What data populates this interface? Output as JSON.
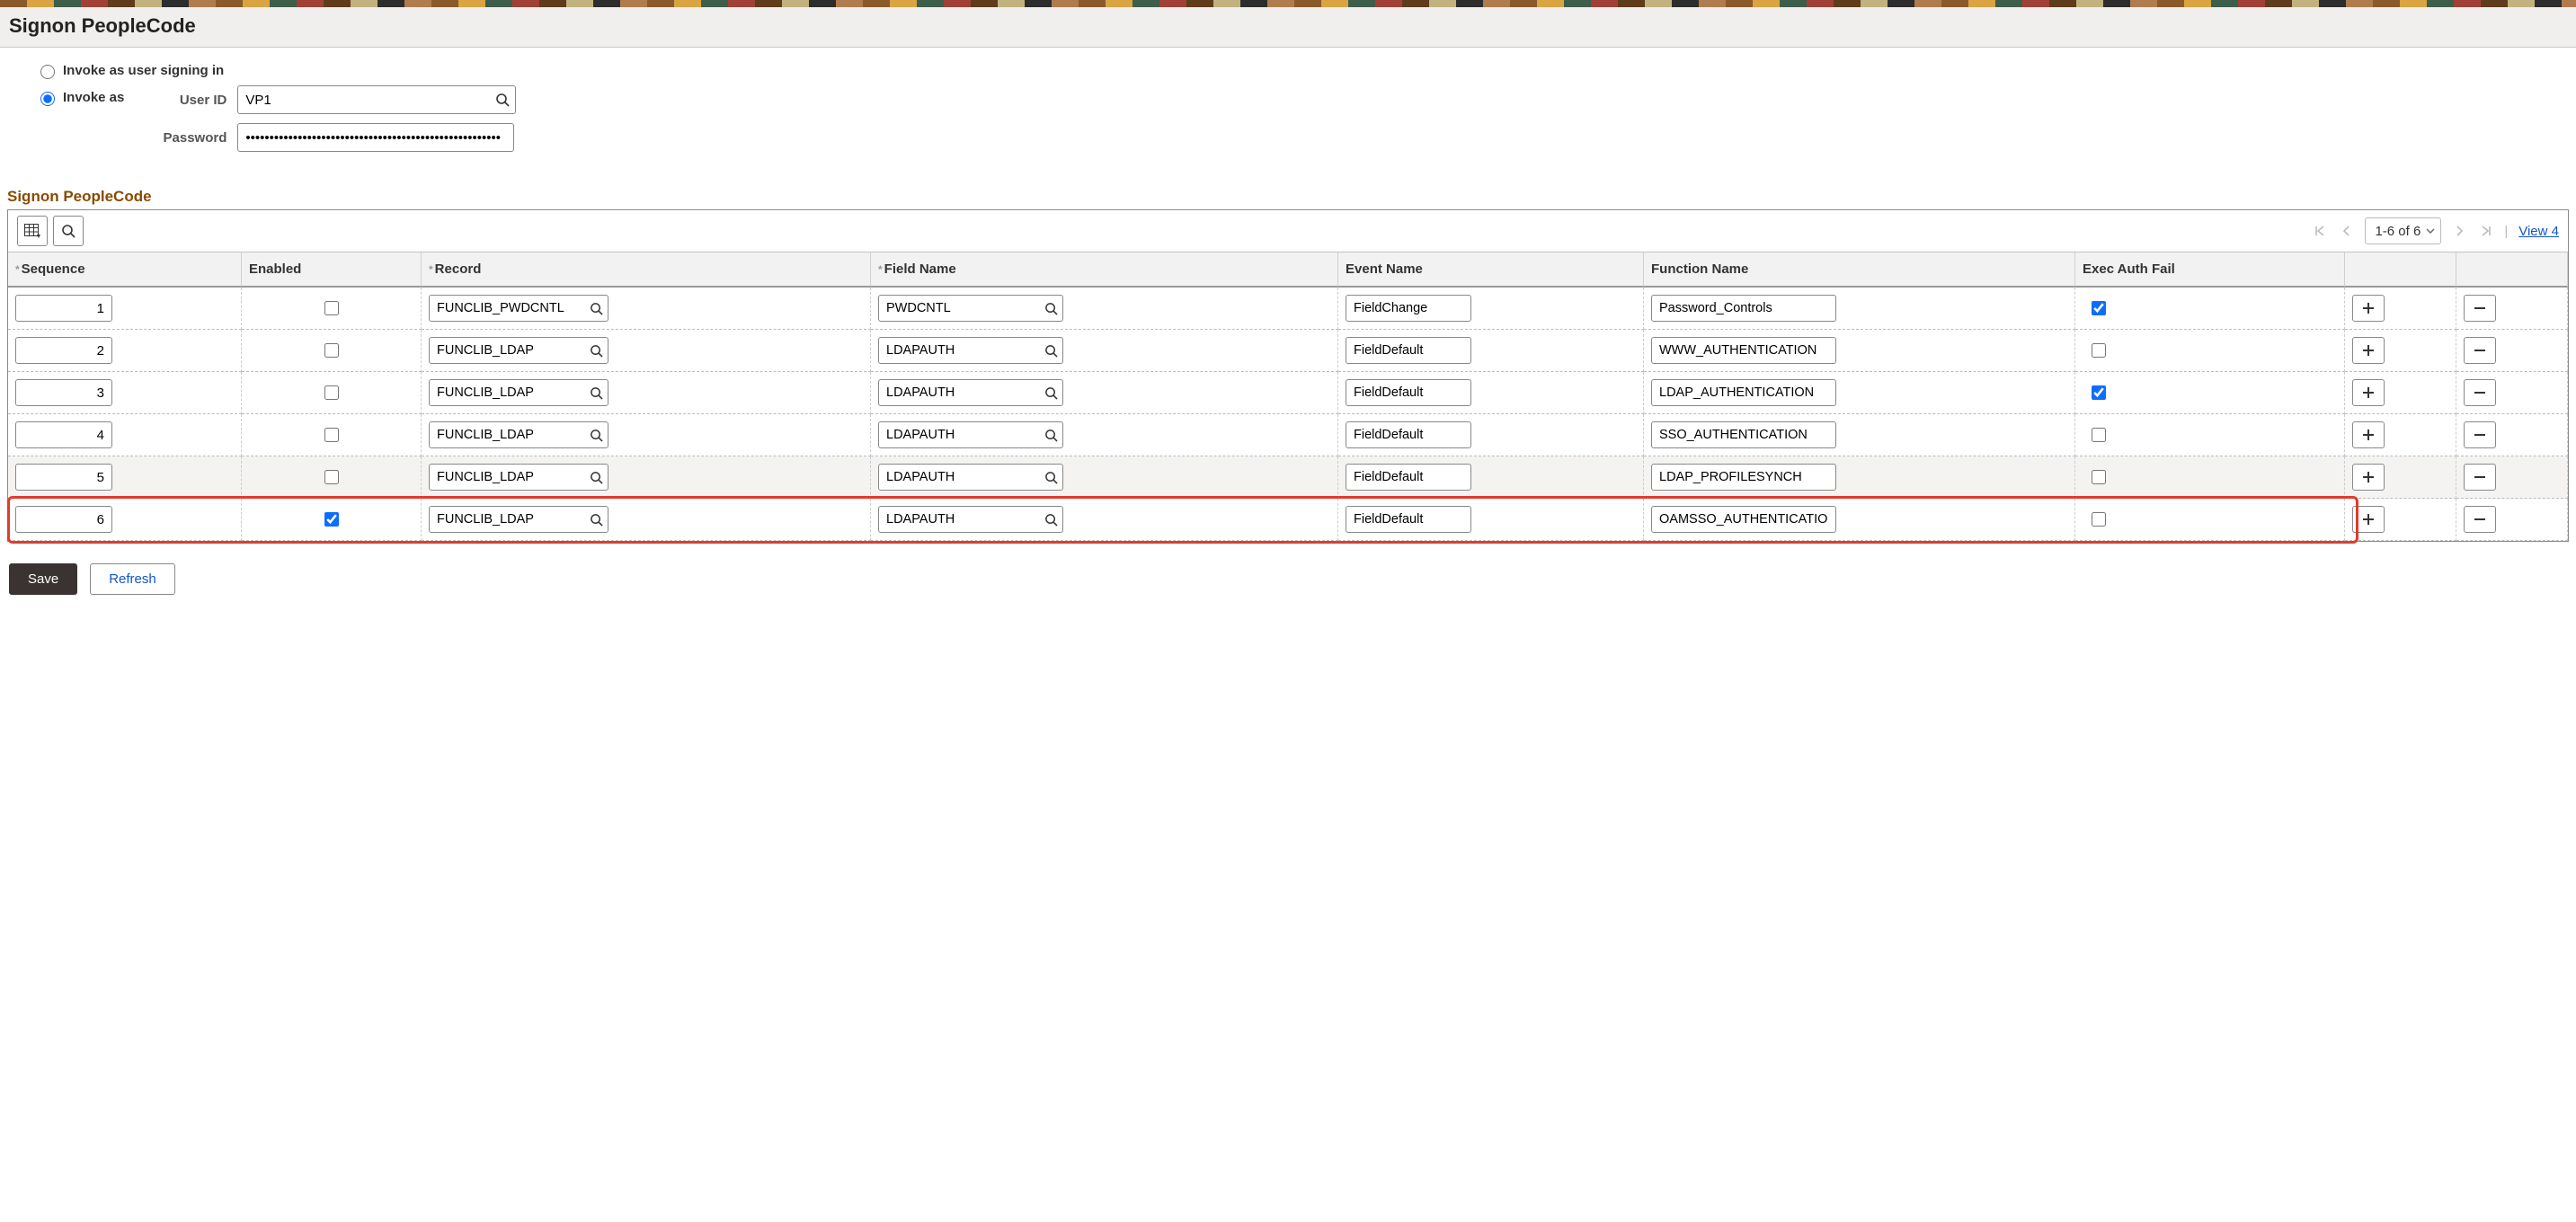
{
  "page": {
    "title": "Signon PeopleCode"
  },
  "invoke": {
    "opt_signing_in": "Invoke as user signing in",
    "opt_as": "Invoke as",
    "selected": "as",
    "userid_label": "User ID",
    "userid_value": "VP1",
    "password_label": "Password",
    "password_value": "••••••••••••••••••••••••••••••••••••••••••••••••••••••"
  },
  "grid": {
    "section_title": "Signon PeopleCode",
    "nav": {
      "range": "1-6 of 6",
      "view_label": "View 4"
    },
    "columns": {
      "sequence": "Sequence",
      "enabled": "Enabled",
      "record": "Record",
      "field": "Field Name",
      "event": "Event Name",
      "func": "Function Name",
      "exec": "Exec Auth Fail"
    },
    "rows": [
      {
        "seq": "1",
        "enabled": false,
        "record": "FUNCLIB_PWDCNTL",
        "field": "PWDCNTL",
        "event": "FieldChange",
        "func": "Password_Controls",
        "exec": true,
        "highlight": false
      },
      {
        "seq": "2",
        "enabled": false,
        "record": "FUNCLIB_LDAP",
        "field": "LDAPAUTH",
        "event": "FieldDefault",
        "func": "WWW_AUTHENTICATION",
        "exec": false,
        "highlight": false
      },
      {
        "seq": "3",
        "enabled": false,
        "record": "FUNCLIB_LDAP",
        "field": "LDAPAUTH",
        "event": "FieldDefault",
        "func": "LDAP_AUTHENTICATION",
        "exec": true,
        "highlight": false
      },
      {
        "seq": "4",
        "enabled": false,
        "record": "FUNCLIB_LDAP",
        "field": "LDAPAUTH",
        "event": "FieldDefault",
        "func": "SSO_AUTHENTICATION",
        "exec": false,
        "highlight": false
      },
      {
        "seq": "5",
        "enabled": false,
        "record": "FUNCLIB_LDAP",
        "field": "LDAPAUTH",
        "event": "FieldDefault",
        "func": "LDAP_PROFILESYNCH",
        "exec": false,
        "highlight": false
      },
      {
        "seq": "6",
        "enabled": true,
        "record": "FUNCLIB_LDAP",
        "field": "LDAPAUTH",
        "event": "FieldDefault",
        "func": "OAMSSO_AUTHENTICATION",
        "exec": false,
        "highlight": true
      }
    ]
  },
  "footer": {
    "save": "Save",
    "refresh": "Refresh"
  }
}
